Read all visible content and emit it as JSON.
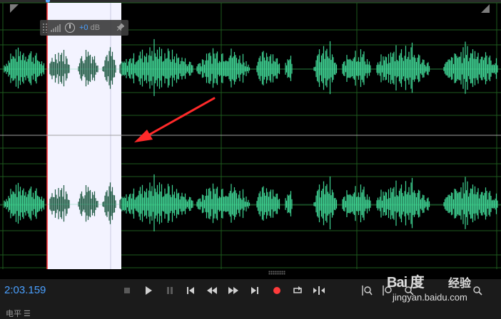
{
  "hud": {
    "gain_value": "+0",
    "gain_unit": "dB"
  },
  "transport": {
    "time": "2:03.159",
    "icons": [
      "stop-icon",
      "play-icon",
      "pause-icon",
      "go-to-start-icon",
      "rewind-icon",
      "fast-forward-icon",
      "go-to-end-icon",
      "record-icon",
      "loop-icon",
      "skip-selection-icon",
      "zoom-in-amplitude-icon",
      "zoom-out-amplitude-icon",
      "zoom-in-time-icon",
      "zoom-out-time-icon"
    ]
  },
  "status": {
    "label": "电平 ☰"
  },
  "watermark": {
    "logo": "Bai 度",
    "cn": "经验",
    "url": "jingyan.baidu.com"
  },
  "colors": {
    "waveform": "#3fd494",
    "waveform_selected": "#1f5a43",
    "selection": "#f3f3ff",
    "grid": "#1e5a1e",
    "time_display": "#4aa0ff",
    "record": "#ff3b3b",
    "arrow": "#ff2a2a"
  }
}
